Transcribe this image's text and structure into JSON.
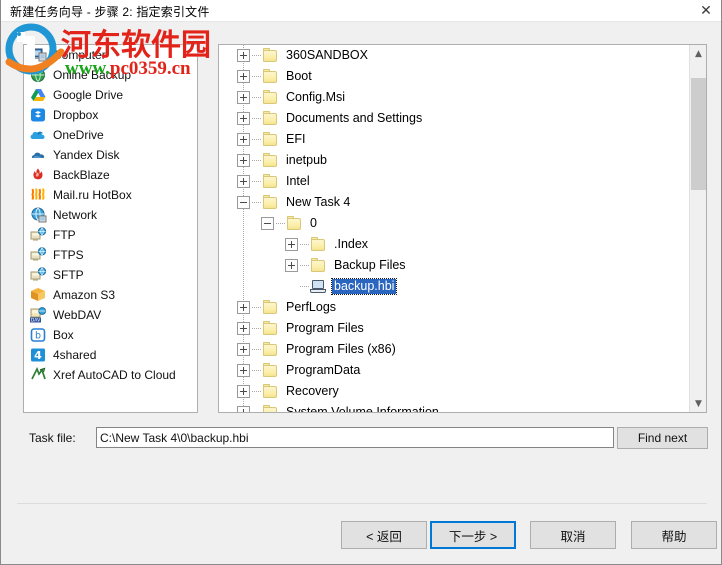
{
  "window": {
    "title": "新建任务向导 - 步骤 2: 指定索引文件",
    "close_icon": "close-icon"
  },
  "watermark": {
    "site_name": "河东软件园",
    "url_prefix": "www",
    "url_dot": ".",
    "url_suffix": "pc0359.cn"
  },
  "sidebar": {
    "items": [
      {
        "label": "Computer",
        "icon": "computer-icon"
      },
      {
        "label": "Online Backup",
        "icon": "globe-icon"
      },
      {
        "label": "Google Drive",
        "icon": "google-drive-icon"
      },
      {
        "label": "Dropbox",
        "icon": "dropbox-icon"
      },
      {
        "label": "OneDrive",
        "icon": "onedrive-cloud-icon"
      },
      {
        "label": "Yandex Disk",
        "icon": "yandex-disk-icon"
      },
      {
        "label": "BackBlaze",
        "icon": "backblaze-flame-icon"
      },
      {
        "label": "Mail.ru HotBox",
        "icon": "mailru-hotbox-icon"
      },
      {
        "label": "Network",
        "icon": "network-icon"
      },
      {
        "label": "FTP",
        "icon": "ftp-icon"
      },
      {
        "label": "FTPS",
        "icon": "ftps-icon"
      },
      {
        "label": "SFTP",
        "icon": "sftp-icon"
      },
      {
        "label": "Amazon S3",
        "icon": "amazon-s3-icon"
      },
      {
        "label": "WebDAV",
        "icon": "webdav-icon"
      },
      {
        "label": "Box",
        "icon": "box-icon"
      },
      {
        "label": "4shared",
        "icon": "4shared-icon"
      },
      {
        "label": "Xref AutoCAD to Cloud",
        "icon": "xref-autocad-icon"
      }
    ]
  },
  "tree": {
    "nodes": [
      {
        "label": "360SANDBOX",
        "depth": 0,
        "expander": "plus",
        "type": "folder",
        "selected": false
      },
      {
        "label": "Boot",
        "depth": 0,
        "expander": "plus",
        "type": "folder",
        "selected": false
      },
      {
        "label": "Config.Msi",
        "depth": 0,
        "expander": "plus",
        "type": "folder",
        "selected": false
      },
      {
        "label": "Documents and Settings",
        "depth": 0,
        "expander": "plus",
        "type": "folder",
        "selected": false
      },
      {
        "label": "EFI",
        "depth": 0,
        "expander": "plus",
        "type": "folder",
        "selected": false
      },
      {
        "label": "inetpub",
        "depth": 0,
        "expander": "plus",
        "type": "folder",
        "selected": false
      },
      {
        "label": "Intel",
        "depth": 0,
        "expander": "plus",
        "type": "folder",
        "selected": false
      },
      {
        "label": "New Task 4",
        "depth": 0,
        "expander": "minus",
        "type": "folder",
        "selected": false
      },
      {
        "label": "0",
        "depth": 1,
        "expander": "minus",
        "type": "folder",
        "selected": false
      },
      {
        "label": ".Index",
        "depth": 2,
        "expander": "plus",
        "type": "folder",
        "selected": false
      },
      {
        "label": "Backup Files",
        "depth": 2,
        "expander": "plus",
        "type": "folder",
        "selected": false
      },
      {
        "label": "backup.hbi",
        "depth": 2,
        "expander": "none",
        "type": "file",
        "selected": true
      },
      {
        "label": "PerfLogs",
        "depth": 0,
        "expander": "plus",
        "type": "folder",
        "selected": false
      },
      {
        "label": "Program Files",
        "depth": 0,
        "expander": "plus",
        "type": "folder",
        "selected": false
      },
      {
        "label": "Program Files (x86)",
        "depth": 0,
        "expander": "plus",
        "type": "folder",
        "selected": false
      },
      {
        "label": "ProgramData",
        "depth": 0,
        "expander": "plus",
        "type": "folder",
        "selected": false
      },
      {
        "label": "Recovery",
        "depth": 0,
        "expander": "plus",
        "type": "folder",
        "selected": false
      },
      {
        "label": "System Volume Information",
        "depth": 0,
        "expander": "plus",
        "type": "folder",
        "selected": false
      }
    ],
    "scroll_up_icon": "chevron-up-icon",
    "scroll_down_icon": "chevron-down-icon"
  },
  "taskfile": {
    "label": "Task file:",
    "value": "C:\\New Task 4\\0\\backup.hbi",
    "placeholder": "",
    "find_next_label": "Find next"
  },
  "buttons": {
    "back": "< 返回",
    "next": "下一步 >",
    "cancel": "取消",
    "help": "帮助"
  },
  "colors": {
    "accent": "#0078d7",
    "selection": "#2a65bf",
    "watermark_red": "#e2231a",
    "watermark_green": "#19a319"
  }
}
